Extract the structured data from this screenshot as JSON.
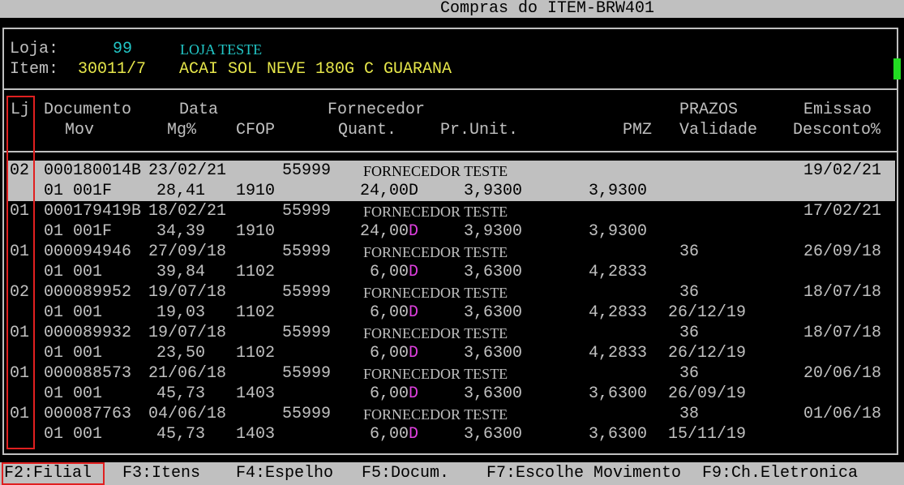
{
  "window": {
    "title": "Compras do ITEM-BRW401"
  },
  "header": {
    "store_label": "Loja:",
    "store_code": "99",
    "store_name": "LOJA TESTE",
    "item_label": "Item:",
    "item_code": "30011/7",
    "item_desc": "ACAI SOL NEVE 180G C GUARANA"
  },
  "columns": {
    "lj": "Lj",
    "documento": "Documento",
    "data": "Data",
    "fornecedor": "Fornecedor",
    "prazos": "PRAZOS",
    "emissao": "Emissao",
    "mov": "Mov",
    "mg": "Mg%",
    "cfop": "CFOP",
    "quant": "Quant.",
    "prunit": "Pr.Unit.",
    "pmz": "PMZ",
    "validade": "Validade",
    "desconto": "Desconto%"
  },
  "rows": [
    {
      "lj": "02",
      "doc": "000180014B",
      "date": "23/02/21",
      "code": "55999",
      "supplier": "FORNECEDOR TESTE",
      "prazo": "",
      "emissao": "19/02/21",
      "mov": "01 001F",
      "mg": "28,41",
      "cfop": "1910",
      "quant": "24,00",
      "qflag": "D",
      "prunit": "3,9300",
      "pmz": "3,9300",
      "validade": ""
    },
    {
      "lj": "01",
      "doc": "000179419B",
      "date": "18/02/21",
      "code": "55999",
      "supplier": "FORNECEDOR TESTE",
      "prazo": "",
      "emissao": "17/02/21",
      "mov": "01 001F",
      "mg": "34,39",
      "cfop": "1910",
      "quant": "24,00",
      "qflag": "D",
      "prunit": "3,9300",
      "pmz": "3,9300",
      "validade": ""
    },
    {
      "lj": "01",
      "doc": "000094946",
      "date": "27/09/18",
      "code": "55999",
      "supplier": "FORNECEDOR TESTE",
      "prazo": "36",
      "emissao": "26/09/18",
      "mov": "01 001",
      "mg": "39,84",
      "cfop": "1102",
      "quant": "6,00",
      "qflag": "D",
      "prunit": "3,6300",
      "pmz": "4,2833",
      "validade": ""
    },
    {
      "lj": "02",
      "doc": "000089952",
      "date": "19/07/18",
      "code": "55999",
      "supplier": "FORNECEDOR TESTE",
      "prazo": "36",
      "emissao": "18/07/18",
      "mov": "01 001",
      "mg": "19,03",
      "cfop": "1102",
      "quant": "6,00",
      "qflag": "D",
      "prunit": "3,6300",
      "pmz": "4,2833",
      "validade": "26/12/19"
    },
    {
      "lj": "01",
      "doc": "000089932",
      "date": "19/07/18",
      "code": "55999",
      "supplier": "FORNECEDOR TESTE",
      "prazo": "36",
      "emissao": "18/07/18",
      "mov": "01 001",
      "mg": "23,50",
      "cfop": "1102",
      "quant": "6,00",
      "qflag": "D",
      "prunit": "3,6300",
      "pmz": "4,2833",
      "validade": "26/12/19"
    },
    {
      "lj": "01",
      "doc": "000088573",
      "date": "21/06/18",
      "code": "55999",
      "supplier": "FORNECEDOR TESTE",
      "prazo": "36",
      "emissao": "20/06/18",
      "mov": "01 001",
      "mg": "45,73",
      "cfop": "1403",
      "quant": "6,00",
      "qflag": "D",
      "prunit": "3,6300",
      "pmz": "3,6300",
      "validade": "26/09/19"
    },
    {
      "lj": "01",
      "doc": "000087763",
      "date": "04/06/18",
      "code": "55999",
      "supplier": "FORNECEDOR TESTE",
      "prazo": "38",
      "emissao": "01/06/18",
      "mov": "01 001",
      "mg": "45,73",
      "cfop": "1403",
      "quant": "6,00",
      "qflag": "D",
      "prunit": "3,6300",
      "pmz": "3,6300",
      "validade": "15/11/19"
    }
  ],
  "function_keys": [
    "F2:Filial",
    "F3:Itens",
    "F4:Espelho",
    "F5:Docum.",
    "F7:Escolhe Movimento",
    "F9:Ch.Eletronica"
  ],
  "colors": {
    "background": "#000000",
    "text": "#c0c0c0",
    "cyan": "#22c7c7",
    "yellow": "#e6e64a",
    "magenta": "#e040e0",
    "highlight": "#e02020"
  }
}
